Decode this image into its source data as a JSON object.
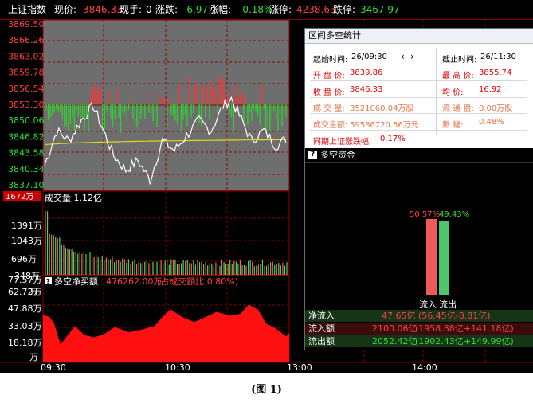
{
  "header": {
    "index_name": "上证指数",
    "price_label": "现价:",
    "price": "3846.33",
    "hand_label": "现手:",
    "hand": "0",
    "change_label": "涨跌:",
    "change": "-6.97",
    "change_pct_label": "涨幅:",
    "change_pct": "-0.18%",
    "limit_up_label": "涨停:",
    "limit_up": "4238.63",
    "limit_down_label": "跌停:",
    "limit_down": "3467.97"
  },
  "price_axis": {
    "ticks": [
      "3869.50",
      "3866.26",
      "3863.02",
      "3859.78",
      "3856.54",
      "3853.30",
      "3850.06",
      "3846.82",
      "3843.58",
      "3840.34",
      "3837.10"
    ],
    "reference": 3853.3
  },
  "volume_axis": {
    "label": "成交量 1.12亿",
    "ticks": [
      "1672万",
      "1391万",
      "1043万",
      "696万",
      "348万",
      "万"
    ]
  },
  "money_axis": {
    "label": "多空净买额",
    "value": "476262.00万",
    "ratio": "(占成交额比 0.80%)",
    "ticks": [
      "77.57万",
      "62.72万",
      "47.88万",
      "33.03万",
      "18.18万",
      "万"
    ]
  },
  "time_axis": {
    "ticks": [
      "09:30",
      "10:30",
      "13:00",
      "14:00"
    ]
  },
  "stats_panel": {
    "title": "区间多空统计",
    "start_label": "起始时间:",
    "start_time": "26/09:30",
    "prev_icon": "chevron-left-icon",
    "next_icon": "chevron-right-icon",
    "end_label": "截止时间:",
    "end_time": "26/11:30",
    "open_label": "开 盘 价:",
    "open": "3839.86",
    "high_label": "最 高 价:",
    "high": "3855.74",
    "close_label": "收 盘 价:",
    "close": "3846.33",
    "avg_label": "均    价:",
    "avg": "16.92",
    "vol_label": "成 交 量:",
    "vol": "3521060.04万股",
    "float_label": "流 通 盘:",
    "float": "0.00万股",
    "amount_label": "成交金额:",
    "amount": "59586720.56万元",
    "amp_label": "振    幅:",
    "amp": "0.48%",
    "same_period_label": "同期上证涨跌幅:",
    "same_period": "0.17%"
  },
  "fund_panel": {
    "title": "多空资金",
    "inflow_pct": "50.57%",
    "outflow_pct": "49.43%",
    "inflow_label": "流入",
    "outflow_label": "流出",
    "rows": [
      {
        "label": "净流入",
        "value": "47.65亿",
        "detail": "(56.45亿-8.81亿)"
      },
      {
        "label": "流入额",
        "value": "2100.06亿",
        "detail": "(1958.88亿+141.18亿)"
      },
      {
        "label": "流出额",
        "value": "2052.42亿",
        "detail": "(1902.43亿+149.99亿)"
      }
    ]
  },
  "colors": {
    "up": "#ff3333",
    "down": "#33cc33",
    "price_line": "#ffffff",
    "avg_line": "#e6d41a",
    "grid": "#8a0000",
    "axis_text": "#ff4040"
  },
  "caption": "(图 1)"
}
